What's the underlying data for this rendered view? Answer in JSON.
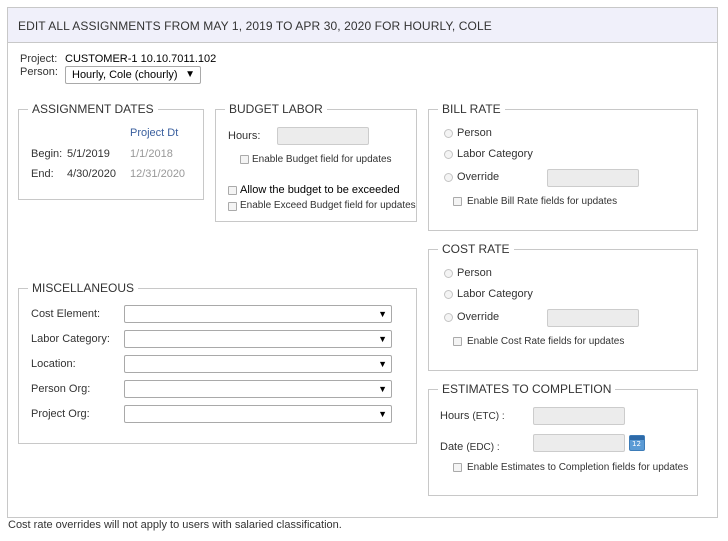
{
  "header": {
    "title": "EDIT ALL ASSIGNMENTS FROM MAY 1, 2019 TO APR 30, 2020 FOR HOURLY, COLE"
  },
  "project": {
    "label": "Project:",
    "value": "CUSTOMER-1 10.10.7011.102"
  },
  "person": {
    "label": "Person:",
    "selected": "Hourly, Cole (chourly)"
  },
  "assignment_dates": {
    "legend": "ASSIGNMENT DATES",
    "project_dt_header": "Project Dt",
    "begin": {
      "label": "Begin:",
      "value": "5/1/2019",
      "project_dt": "1/1/2018"
    },
    "end": {
      "label": "End:",
      "value": "4/30/2020",
      "project_dt": "12/31/2020"
    }
  },
  "budget_labor": {
    "legend": "BUDGET LABOR",
    "hours_label": "Hours:",
    "enable_budget": "Enable Budget field for updates",
    "allow_exceed": "Allow the budget to be exceeded",
    "enable_exceed": "Enable Exceed Budget field for updates"
  },
  "bill_rate": {
    "legend": "BILL RATE",
    "options": [
      "Person",
      "Labor Category",
      "Override"
    ],
    "enable": "Enable Bill Rate fields for updates"
  },
  "cost_rate": {
    "legend": "COST RATE",
    "options": [
      "Person",
      "Labor Category",
      "Override"
    ],
    "enable": "Enable Cost Rate fields for updates"
  },
  "estimates": {
    "legend": "ESTIMATES TO COMPLETION",
    "hours_label": "Hours",
    "hours_suffix": "(ETC) :",
    "date_label": "Date",
    "date_suffix": "(EDC) :",
    "calendar_day": "12",
    "enable": "Enable Estimates to Completion fields for updates"
  },
  "miscellaneous": {
    "legend": "MISCELLANEOUS",
    "fields": [
      "Cost Element:",
      "Labor Category:",
      "Location:",
      "Person Org:",
      "Project Org:"
    ]
  },
  "footer": {
    "note": "Cost rate overrides will not apply to users with salaried classification."
  }
}
